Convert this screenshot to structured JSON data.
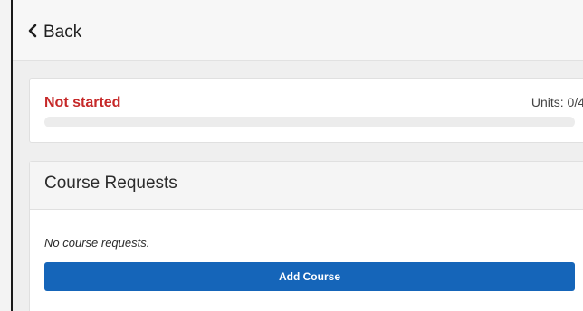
{
  "nav": {
    "back_label": "Back",
    "back_icon": "chevron-left-icon"
  },
  "status": {
    "label": "Not started",
    "label_color": "#c62828",
    "units": "Units: 0/4",
    "progress_fraction": 0
  },
  "course_requests": {
    "title": "Course Requests",
    "empty_message": "No course requests.",
    "add_button_label": "Add Course",
    "button_color": "#1565b9"
  }
}
